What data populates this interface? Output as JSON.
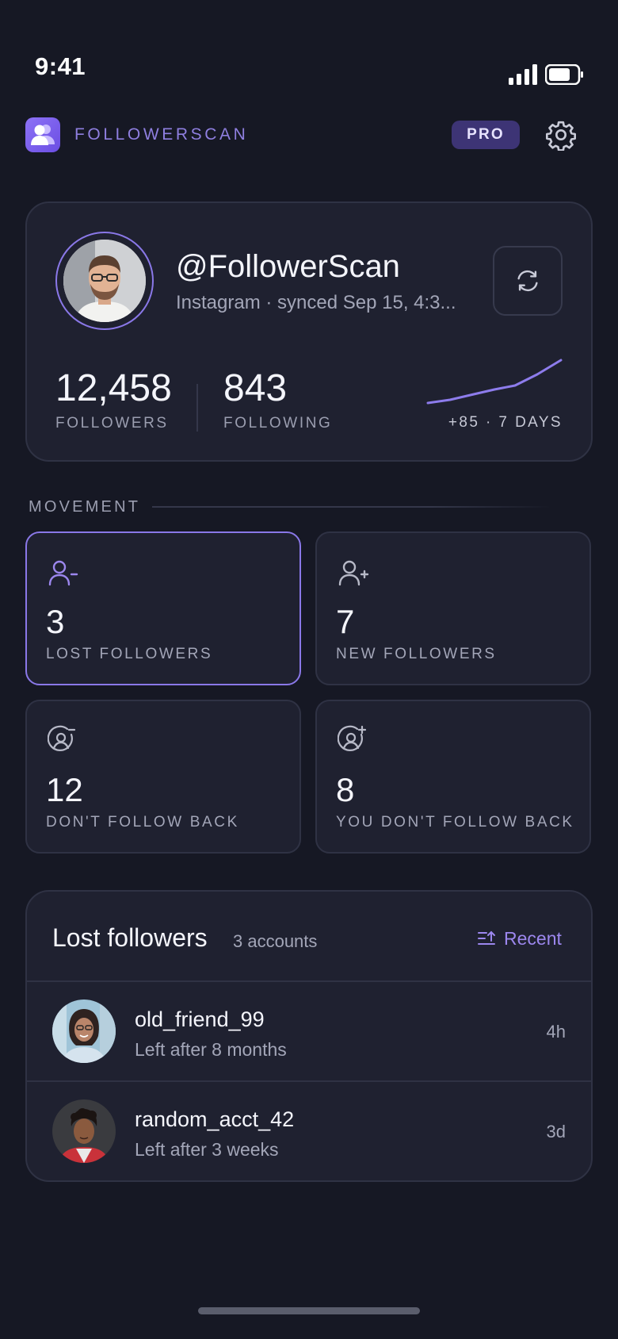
{
  "status_bar": {
    "time": "9:41"
  },
  "app": {
    "name": "FOLLOWERSCAN",
    "badge": "PRO",
    "accent": "#8a78e8"
  },
  "profile": {
    "handle": "@FollowerScan",
    "sync_info": "Instagram · synced Sep 15, 4:3...",
    "followers_value": "12,458",
    "followers_label": "FOLLOWERS",
    "following_value": "843",
    "following_label": "FOLLOWING",
    "trend_label": "+85 · 7 DAYS"
  },
  "movement": {
    "title": "MOVEMENT",
    "tiles": [
      {
        "value": "3",
        "label": "LOST FOLLOWERS",
        "icon": "user-minus-icon",
        "active": true
      },
      {
        "value": "7",
        "label": "NEW FOLLOWERS",
        "icon": "user-plus-icon",
        "active": false
      },
      {
        "value": "12",
        "label": "DON'T FOLLOW BACK",
        "icon": "circle-user-minus-icon",
        "active": false
      },
      {
        "value": "8",
        "label": "YOU DON'T FOLLOW BACK",
        "icon": "circle-user-plus-icon",
        "active": false
      }
    ]
  },
  "list": {
    "title": "Lost followers",
    "count": "3 accounts",
    "sort_label": "Recent",
    "rows": [
      {
        "name": "old_friend_99",
        "subtitle": "Left after 8 months",
        "time": "4h"
      },
      {
        "name": "random_acct_42",
        "subtitle": "Left after 3 weeks",
        "time": "3d"
      }
    ]
  }
}
